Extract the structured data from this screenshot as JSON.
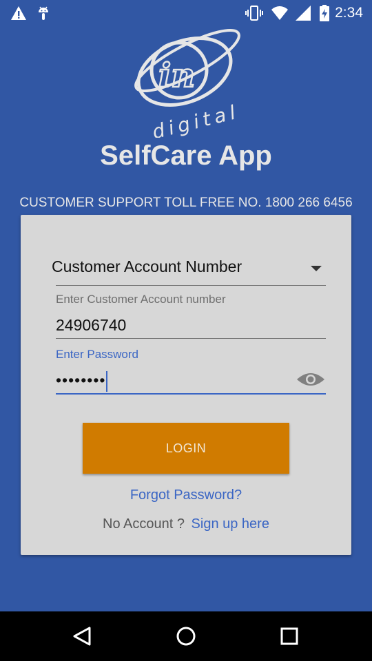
{
  "status_bar": {
    "time": "2:34",
    "icons": [
      "warning-icon",
      "android-debug-icon",
      "vibrate-icon",
      "wifi-icon",
      "signal-icon",
      "battery-charging-icon"
    ]
  },
  "logo": {
    "mark_text": "in",
    "sub_text": "digital"
  },
  "app": {
    "title": "SelfCare App",
    "support_line": "CUSTOMER SUPPORT TOLL FREE NO. 1800 266 6456"
  },
  "form": {
    "login_type": {
      "selected": "Customer Account Number"
    },
    "account": {
      "label": "Enter Customer Account number",
      "value": "24906740"
    },
    "password": {
      "label": "Enter Password",
      "value": "••••••••",
      "visibility_icon": "eye-icon"
    },
    "login_label": "LOGIN",
    "forgot_label": "Forgot Password?",
    "no_account_label": "No Account ?",
    "signup_label": "Sign up here"
  },
  "nav": {
    "icons": [
      "back-icon",
      "home-icon",
      "recents-icon"
    ]
  },
  "colors": {
    "background": "#3157a4",
    "card": "#d7d7d7",
    "accent": "#3b66c4",
    "button": "#d07b00"
  }
}
